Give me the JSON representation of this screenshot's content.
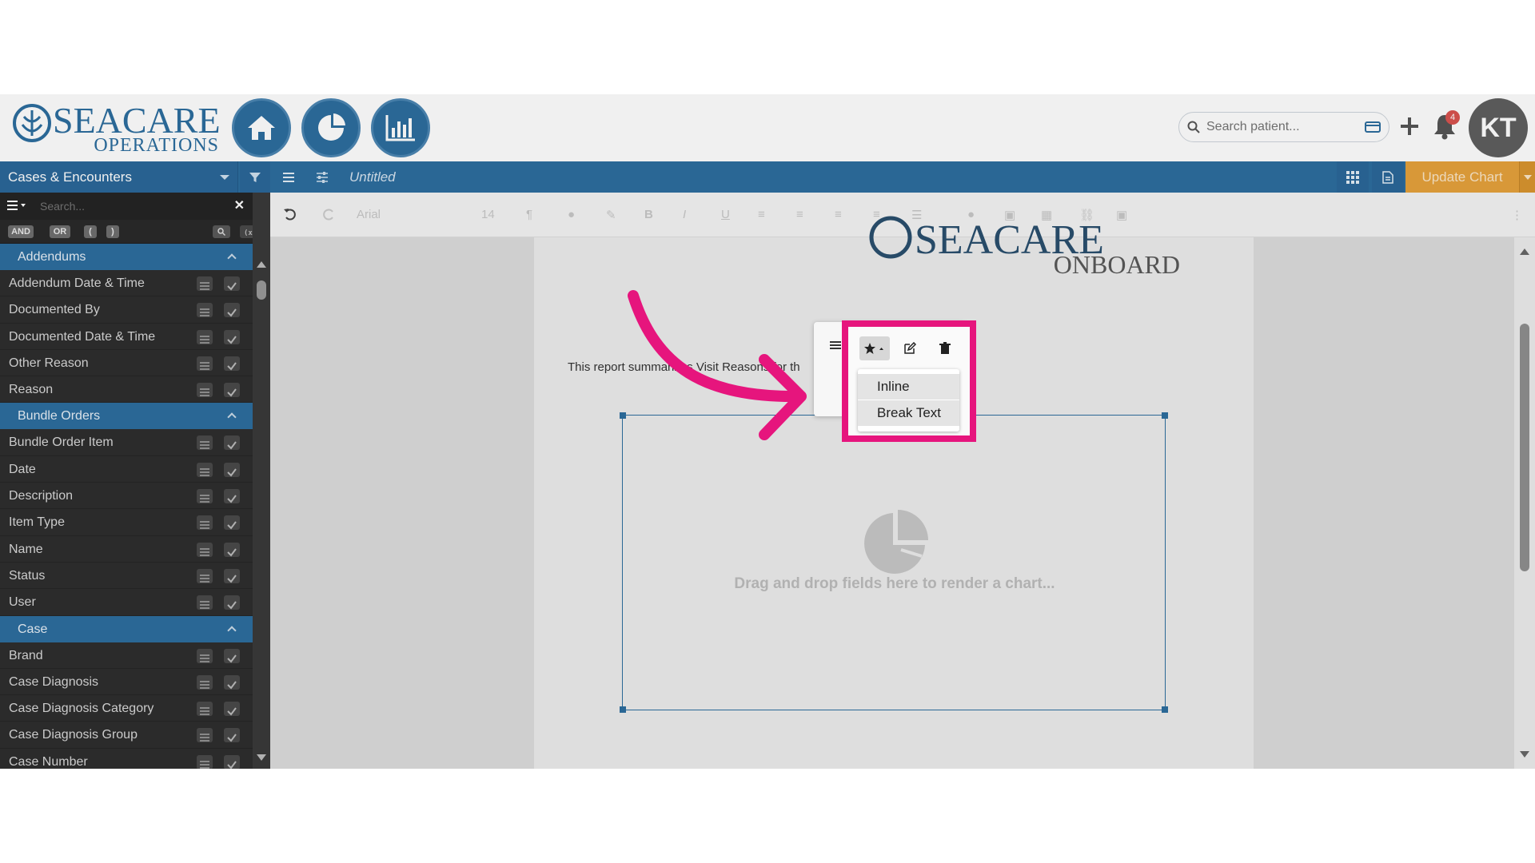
{
  "header": {
    "logo_main": "SEACARE",
    "logo_sub": "OPERATIONS",
    "search_placeholder": "Search patient...",
    "notification_count": "4",
    "avatar_initials": "KT"
  },
  "nav_icons": [
    "home-icon",
    "pie-chart-icon",
    "bar-chart-icon"
  ],
  "bluebar": {
    "dataset": "Cases & Encounters",
    "doc_title": "Untitled",
    "update_label": "Update Chart"
  },
  "sidebar": {
    "search_placeholder": "Search...",
    "ops": [
      "AND",
      "OR",
      "(",
      ")"
    ],
    "sections": [
      {
        "title": "Addendums",
        "items": [
          "Addendum Date & Time",
          "Documented By",
          "Documented Date & Time",
          "Other Reason",
          "Reason"
        ]
      },
      {
        "title": "Bundle Orders",
        "items": [
          "Bundle Order Item",
          "Date",
          "Description",
          "Item Type",
          "Name",
          "Status",
          "User"
        ]
      },
      {
        "title": "Case",
        "items": [
          "Brand",
          "Case Diagnosis",
          "Case Diagnosis Category",
          "Case Diagnosis Group",
          "Case Number"
        ]
      }
    ]
  },
  "toolbar": {
    "font": "Arial",
    "size": "14"
  },
  "document": {
    "logo_main": "SEACARE",
    "logo_sub": "ONBOARD",
    "report_text": "This report summarizes Visit Reasons for th",
    "chart_placeholder": "Drag and drop fields here to render a chart..."
  },
  "widget_menu": {
    "items": [
      "Inline",
      "Break Text"
    ]
  },
  "colors": {
    "brand_blue": "#2d6e9f",
    "accent_orange": "#e6a23c",
    "highlight_pink": "#e6157d",
    "sidebar_bg": "#2e2e2e"
  }
}
